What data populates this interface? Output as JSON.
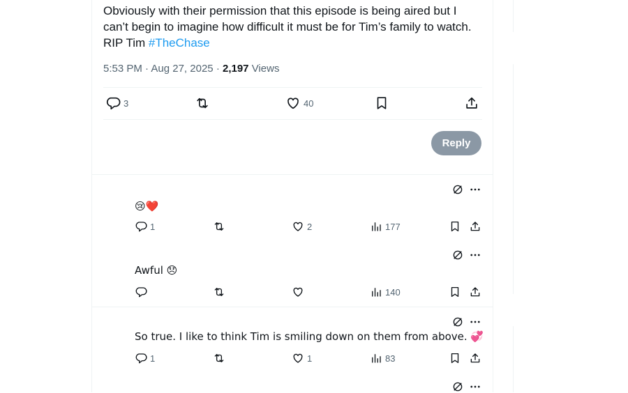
{
  "tweet": {
    "text_line1": "Obviously with their permission that this episode is being aired but I",
    "text_line2": "can’t begin to imagine how difficult it must be for Tim’s family to watch.",
    "text_line3_prefix": "RIP Tim ",
    "hashtag": "#TheChase",
    "time": "5:53 PM",
    "date": "Aug 27, 2025",
    "views_count": "2,197",
    "views_label": "Views",
    "separator": "·",
    "actions": {
      "replies": "3",
      "likes": "40"
    }
  },
  "reply_button": {
    "label": "Reply"
  },
  "replies": [
    {
      "text": "😢❤️",
      "replies": "1",
      "likes": "2",
      "views": "177"
    },
    {
      "text": "Awful 😞",
      "replies": "",
      "likes": "",
      "views": "140"
    },
    {
      "text": "So true. I like to think Tim is smiling down on them from above. 💞",
      "replies": "1",
      "likes": "1",
      "views": "83"
    }
  ],
  "icons": {
    "reply": "reply-icon",
    "retweet": "retweet-icon",
    "like": "heart-icon",
    "bookmark": "bookmark-icon",
    "share": "share-icon",
    "analytics": "analytics-icon",
    "grok": "grok-icon",
    "more": "more-icon"
  },
  "colors": {
    "hashtag": "#1d9bf0",
    "muted": "#536471",
    "button_disabled": "#8b98a5",
    "divider": "#eff3f4"
  }
}
